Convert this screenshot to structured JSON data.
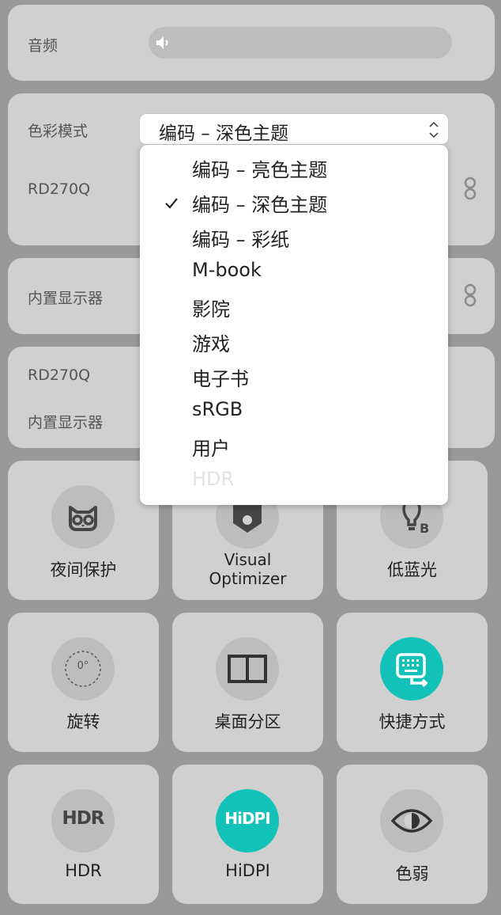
{
  "audio": {
    "label": "音频"
  },
  "color_mode": {
    "label": "色彩模式",
    "selected": "编码 – 深色主题",
    "options": [
      {
        "label": "编码 – 亮色主题",
        "checked": false,
        "disabled": false
      },
      {
        "label": "编码 – 深色主题",
        "checked": true,
        "disabled": false
      },
      {
        "label": "编码 – 彩纸",
        "checked": false,
        "disabled": false
      },
      {
        "label": "M-book",
        "checked": false,
        "disabled": false
      },
      {
        "label": "影院",
        "checked": false,
        "disabled": false
      },
      {
        "label": "游戏",
        "checked": false,
        "disabled": false
      },
      {
        "label": "电子书",
        "checked": false,
        "disabled": false
      },
      {
        "label": "sRGB",
        "checked": false,
        "disabled": false
      },
      {
        "label": "用户",
        "checked": false,
        "disabled": false
      },
      {
        "label": "HDR",
        "checked": false,
        "disabled": true
      }
    ]
  },
  "brightness": {
    "monitor_label": "RD270Q",
    "builtin_label": "内置显示器"
  },
  "volume": {
    "monitor_label": "RD270Q",
    "builtin_label": "内置显示器"
  },
  "tiles": {
    "night_protect": "夜间保护",
    "visual_optimizer_line1": "Visual",
    "visual_optimizer_line2": "Optimizer",
    "low_blue": "低蓝光",
    "rotate": "旋转",
    "rotate_value": "0°",
    "desktop_split": "桌面分区",
    "shortcut": "快捷方式",
    "hdr": "HDR",
    "hdr_icon_text": "HDR",
    "hidpi": "HiDPI",
    "hidpi_icon_text": "HiDPI",
    "color_weak": "色弱"
  },
  "colors": {
    "background": "#999999",
    "card": "#d0d0d0",
    "accent_teal": "#12c2b8"
  }
}
